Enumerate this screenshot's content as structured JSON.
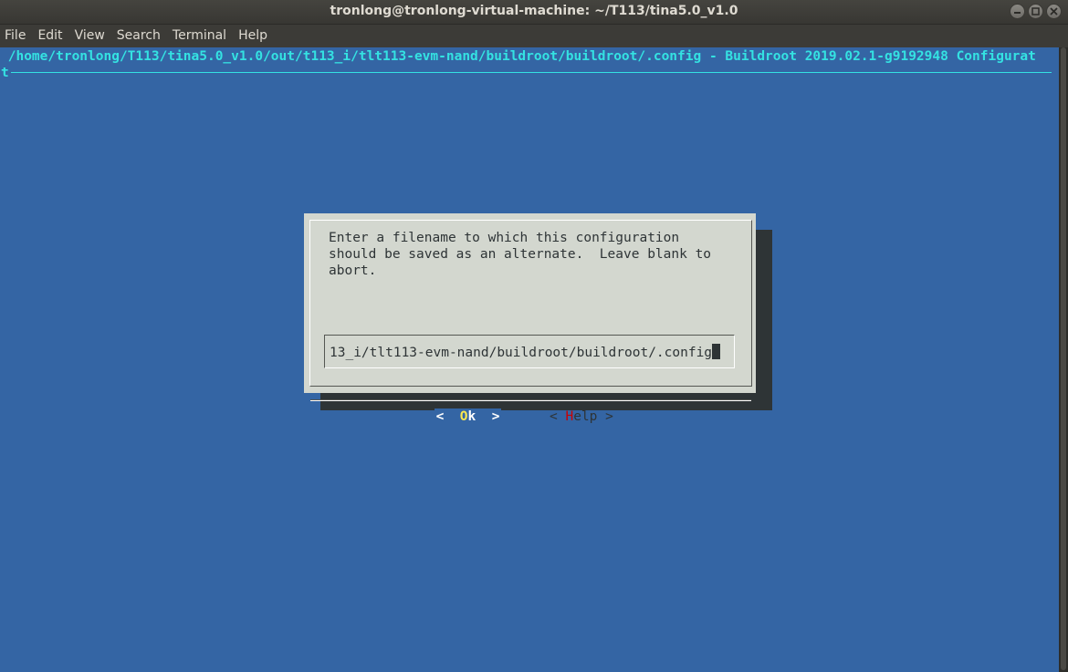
{
  "window": {
    "title": "tronlong@tronlong-virtual-machine: ~/T113/tina5.0_v1.0"
  },
  "menubar": {
    "items": [
      "File",
      "Edit",
      "View",
      "Search",
      "Terminal",
      "Help"
    ]
  },
  "terminal": {
    "backtitle": " /home/tronlong/T113/tina5.0_v1.0/out/t113_i/tlt113-evm-nand/buildroot/buildroot/.config - Buildroot 2019.02.1-g9192948 Configurat",
    "backtitle_wrap": "t"
  },
  "dialog": {
    "prompt": "Enter a filename to which this configuration\nshould be saved as an alternate.  Leave blank to\nabort.",
    "input_value": "13_i/tlt113-evm-nand/buildroot/buildroot/.config",
    "ok_button": {
      "left": "<  ",
      "hotkey": "O",
      "rest": "k  >"
    },
    "help_button": {
      "left": "< ",
      "hotkey": "H",
      "rest": "elp >"
    }
  },
  "colors": {
    "terminal_bg": "#3465a4",
    "backtitle": "#34e2e2",
    "dialog_bg": "#d3d7cf",
    "dialog_shadow": "#2e3436",
    "hotkey_selected": "#fce94f",
    "hotkey": "#cc0000"
  }
}
